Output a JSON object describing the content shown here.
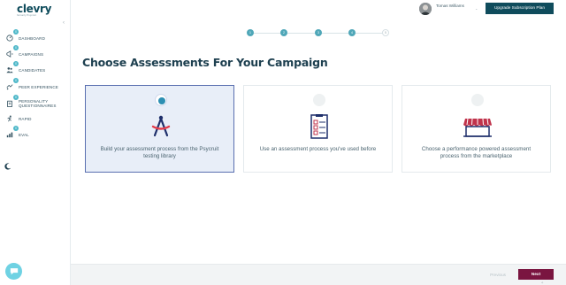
{
  "app": {
    "logo": "clevry",
    "logo_tagline": "formerly Psycruit"
  },
  "sidebar": {
    "items": [
      {
        "label": "DASHBOARD",
        "badge": "0",
        "icon": "speedometer-icon"
      },
      {
        "label": "CAMPAIGNS",
        "badge": "0",
        "icon": "megaphone-icon"
      },
      {
        "label": "CANDIDATES",
        "badge": "0",
        "icon": "people-icon"
      },
      {
        "label": "PEER EXPERIENCE",
        "badge": "0",
        "icon": "handshake-icon"
      },
      {
        "label": "PERSONALITY QUESTIONNAIRES",
        "badge": "0",
        "icon": "clipboard-icon"
      },
      {
        "label": "RAPID",
        "badge": "",
        "icon": "runner-icon"
      },
      {
        "label": "EVAL",
        "badge": "0",
        "icon": "chart-icon"
      }
    ]
  },
  "header": {
    "user_name": "Tomas Williams",
    "upgrade_label": "Upgrade Subscription Plan"
  },
  "stepper": {
    "steps": [
      {
        "label": "1",
        "state": "done"
      },
      {
        "label": "2",
        "state": "done"
      },
      {
        "label": "3",
        "state": "done"
      },
      {
        "label": "4",
        "state": "done"
      },
      {
        "label": "5",
        "state": "todo"
      }
    ]
  },
  "main": {
    "title": "Choose Assessments For Your Campaign",
    "cards": [
      {
        "text": "Build your assessment process from the Psycruit testing library",
        "selected": true,
        "icon": "compass-icon"
      },
      {
        "text": "Use an assessment process you've used before",
        "selected": false,
        "icon": "checklist-icon"
      },
      {
        "text": "Choose a performance powered assessment process from the marketplace",
        "selected": false,
        "icon": "storefront-icon"
      }
    ]
  },
  "footer": {
    "previous_label": "Previous",
    "next_label": "Next"
  },
  "colors": {
    "brand": "#0f4c5c",
    "accent": "#4fa7b8",
    "next_button": "#7a1540",
    "selected_card": "#e8eef8"
  }
}
